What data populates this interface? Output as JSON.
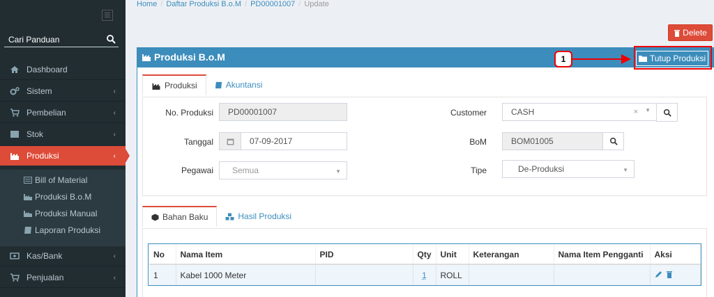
{
  "sidebar": {
    "search_placeholder": "Cari Panduan",
    "menu": [
      {
        "label": "Dashboard",
        "icon": "home-icon"
      },
      {
        "label": "Sistem",
        "icon": "cogs-icon"
      },
      {
        "label": "Pembelian",
        "icon": "cart-icon"
      },
      {
        "label": "Stok",
        "icon": "box-icon"
      },
      {
        "label": "Produksi",
        "icon": "factory-icon",
        "active": true
      },
      {
        "label": "Kas/Bank",
        "icon": "money-icon"
      },
      {
        "label": "Penjualan",
        "icon": "cart-icon"
      }
    ],
    "submenu": [
      {
        "label": "Bill of Material",
        "icon": "list-icon"
      },
      {
        "label": "Produksi B.o.M",
        "icon": "factory-icon"
      },
      {
        "label": "Produksi Manual",
        "icon": "factory-icon"
      },
      {
        "label": "Laporan Produksi",
        "icon": "book-icon"
      }
    ]
  },
  "breadcrumb": {
    "home": "Home",
    "list": "Daftar Produksi B.o.M",
    "record": "PD00001007",
    "current": "Update"
  },
  "actions": {
    "delete_label": "Delete",
    "tutup_label": "Tutup Produksi"
  },
  "annotation": {
    "number": "1"
  },
  "box": {
    "title": "Produksi B.o.M"
  },
  "tabs_top": [
    {
      "label": "Produksi",
      "active": true
    },
    {
      "label": "Akuntansi",
      "active": false
    }
  ],
  "form": {
    "no_produksi_label": "No. Produksi",
    "no_produksi_value": "PD00001007",
    "tanggal_label": "Tanggal",
    "tanggal_value": "07-09-2017",
    "pegawai_label": "Pegawai",
    "pegawai_value": "Semua",
    "customer_label": "Customer",
    "customer_value": "CASH",
    "bom_label": "BoM",
    "bom_value": "BOM01005",
    "tipe_label": "Tipe",
    "tipe_value": "De-Produksi"
  },
  "tabs_bottom": [
    {
      "label": "Bahan Baku",
      "active": true
    },
    {
      "label": "Hasil Produksi",
      "active": false
    }
  ],
  "table": {
    "headers": [
      "No",
      "Nama Item",
      "PID",
      "Qty",
      "Unit",
      "Keterangan",
      "Nama Item Pengganti",
      "Aksi"
    ],
    "rows": [
      {
        "no": "1",
        "nama_item": "Kabel 1000 Meter",
        "pid": "",
        "qty": "1",
        "unit": "ROLL",
        "keterangan": "",
        "pengganti": ""
      }
    ]
  },
  "colors": {
    "primary": "#3c8dbc",
    "danger": "#dd4b39",
    "sidebar_bg": "#222d32",
    "annotation_red": "#ee0000"
  }
}
